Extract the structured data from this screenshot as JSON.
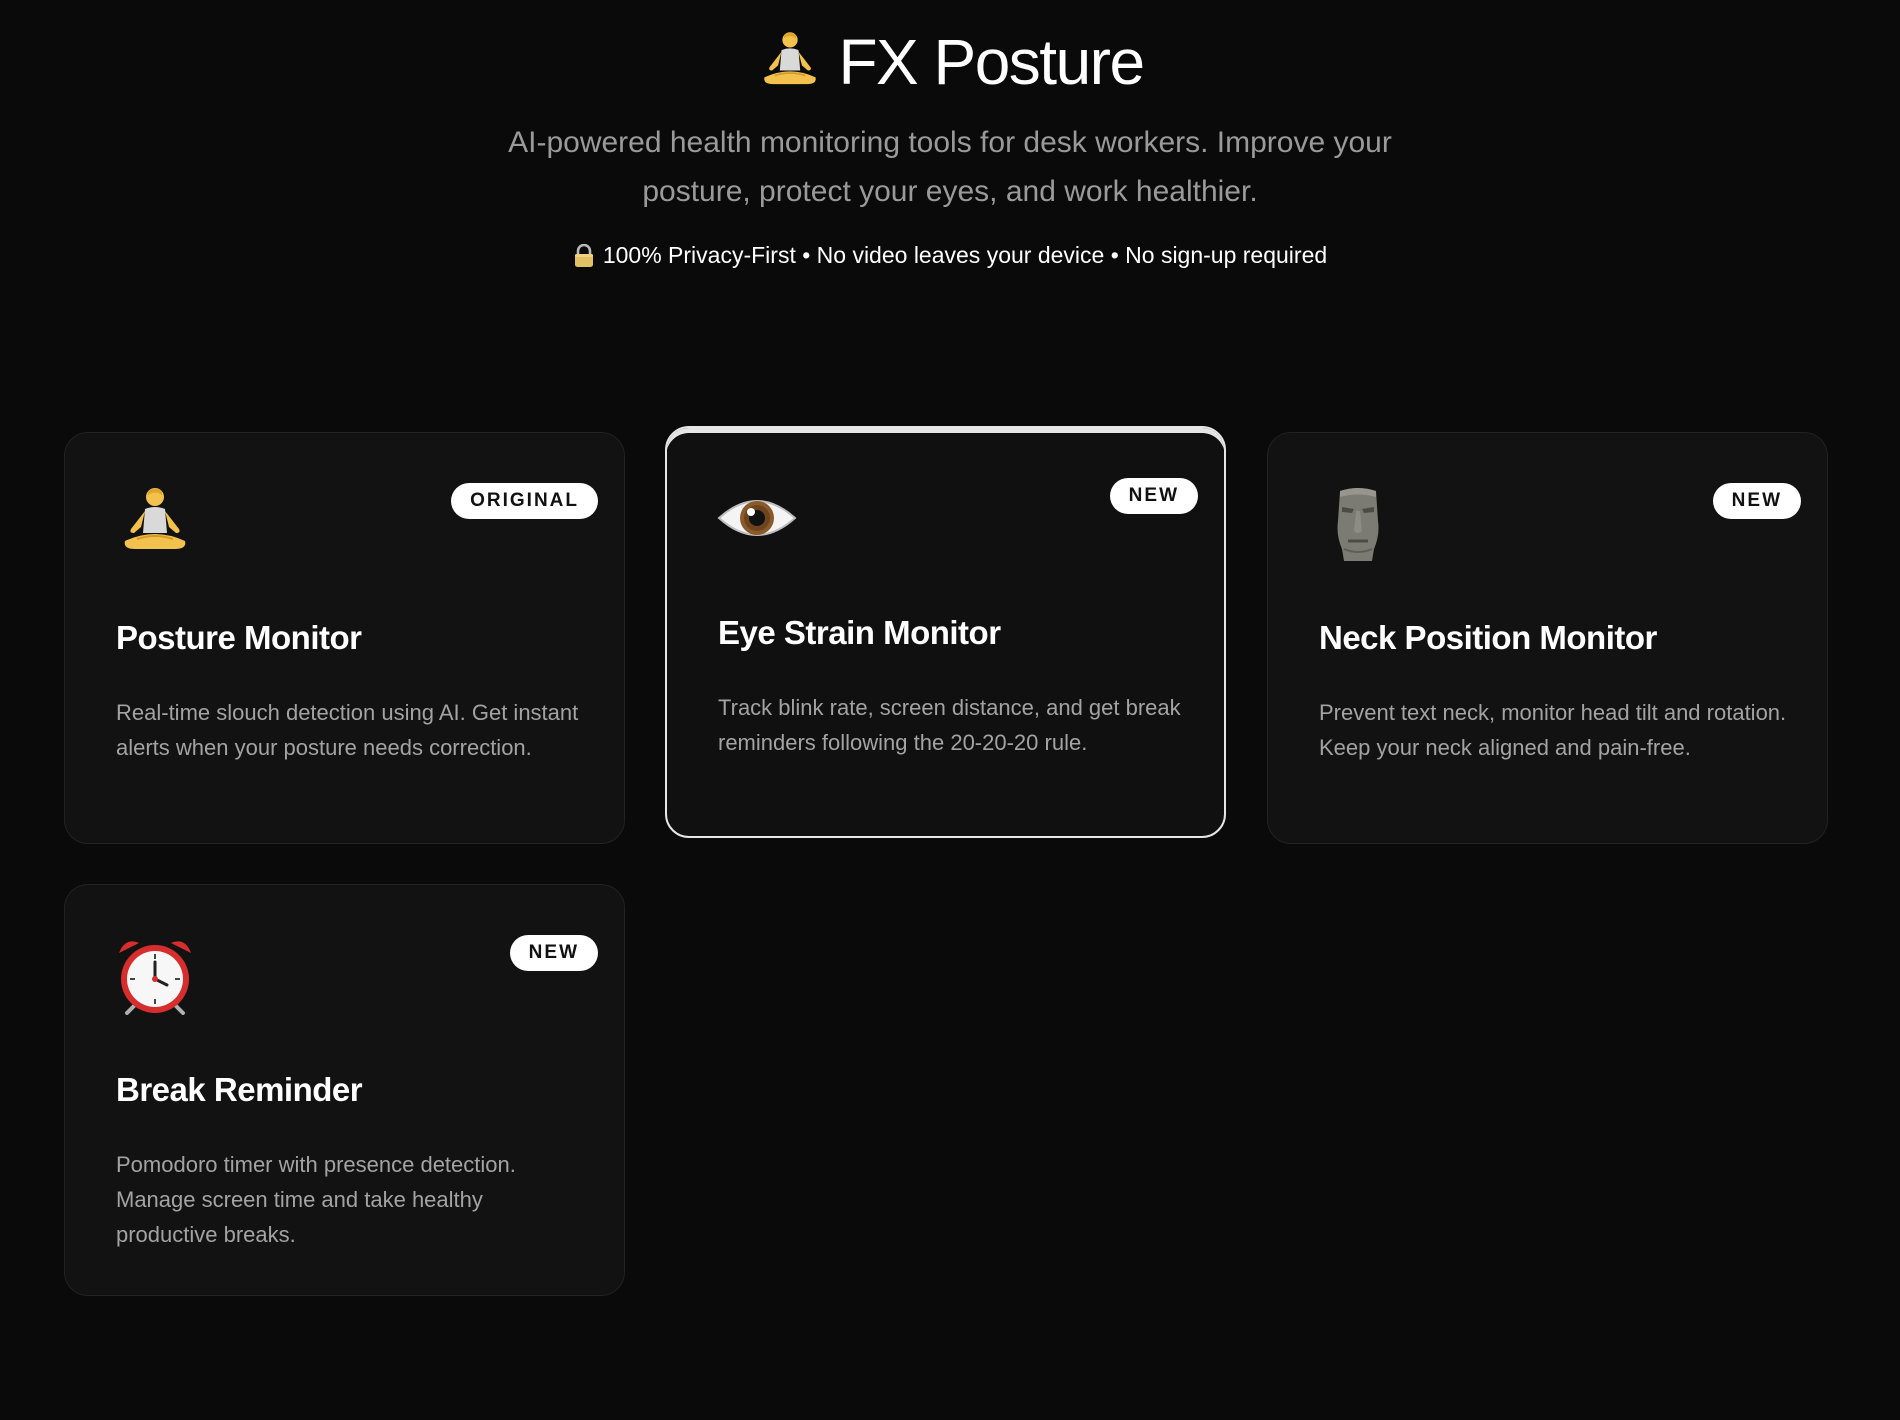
{
  "header": {
    "app_icon": "person-in-lotus-position-icon",
    "title": "FX Posture",
    "subtitle": "AI-powered health monitoring tools for desk workers. Improve your posture, protect your eyes, and work healthier.",
    "privacy_icon": "lock-icon",
    "privacy_text": "100% Privacy-First • No video leaves your device • No sign-up required"
  },
  "tools": [
    {
      "icon": "person-in-lotus-position-icon",
      "badge": "ORIGINAL",
      "title": "Posture Monitor",
      "description": "Real-time slouch detection using AI. Get instant alerts when your posture needs correction."
    },
    {
      "icon": "eye-icon",
      "badge": "NEW",
      "title": "Eye Strain Monitor",
      "description": "Track blink rate, screen distance, and get break reminders following the 20-20-20 rule."
    },
    {
      "icon": "moai-icon",
      "badge": "NEW",
      "title": "Neck Position Monitor",
      "description": "Prevent text neck, monitor head tilt and rotation. Keep your neck aligned and pain-free."
    },
    {
      "icon": "alarm-clock-icon",
      "badge": "NEW",
      "title": "Break Reminder",
      "description": "Pomodoro timer with presence detection. Manage screen time and take healthy productive breaks."
    }
  ],
  "colors": {
    "background": "#0a0a0a",
    "card_background": "#121212",
    "active_card_border": "#e6e6e6",
    "badge_background": "#ffffff",
    "muted_text": "#9a9a9a"
  }
}
